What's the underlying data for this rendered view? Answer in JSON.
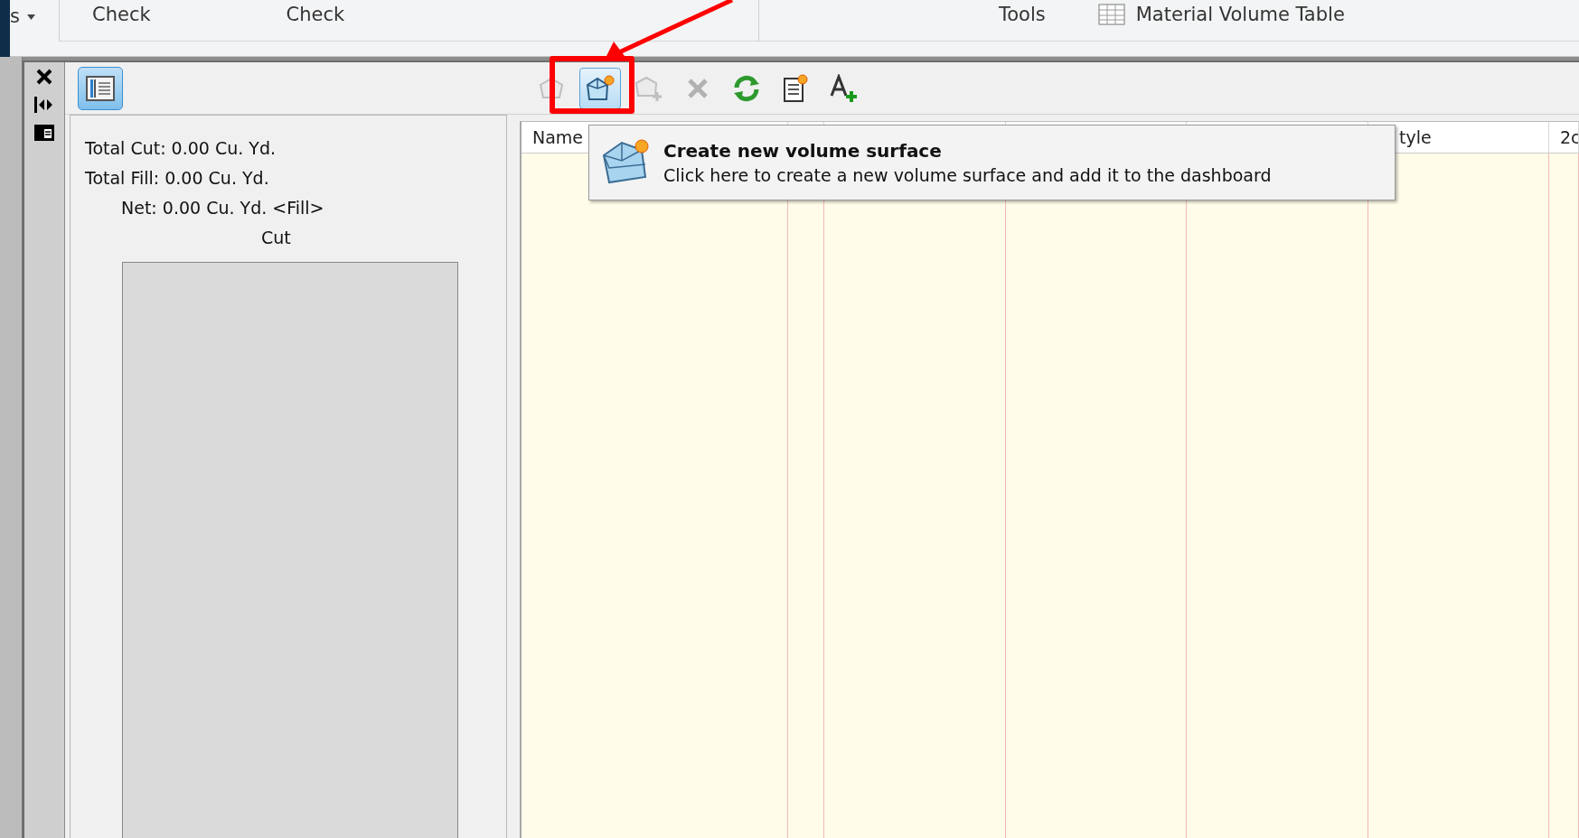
{
  "ribbon": {
    "menu_stub": "s",
    "items": [
      {
        "kind": "text",
        "label": "Check"
      },
      {
        "kind": "text",
        "label": "Check"
      },
      {
        "kind": "text",
        "label": "Tools"
      },
      {
        "kind": "table",
        "label": "Material Volume Table"
      }
    ]
  },
  "panel_toggle": {
    "selected": true
  },
  "toolbar": {
    "buttons": [
      {
        "kind": "volume",
        "disabled": true,
        "selected": false
      },
      {
        "kind": "new-volume",
        "disabled": false,
        "selected": true
      },
      {
        "kind": "add-volume",
        "disabled": true,
        "selected": false
      },
      {
        "kind": "delete",
        "disabled": true,
        "selected": false
      },
      {
        "kind": "refresh",
        "disabled": false,
        "selected": false
      },
      {
        "kind": "report",
        "disabled": false,
        "selected": false
      },
      {
        "kind": "label",
        "disabled": false,
        "selected": false
      }
    ]
  },
  "summary": {
    "total_cut": "Total Cut: 0.00 Cu. Yd.",
    "total_fill": "Total Fill: 0.00 Cu. Yd.",
    "net": "Net: 0.00 Cu. Yd. <Fill>",
    "chart_label": "Cut"
  },
  "table": {
    "column_1": "Name",
    "column_6": "tyle",
    "column_7": "2c"
  },
  "tooltip": {
    "title": "Create new volume surface",
    "text": "Click here to create a new volume surface and add it to the dashboard"
  }
}
